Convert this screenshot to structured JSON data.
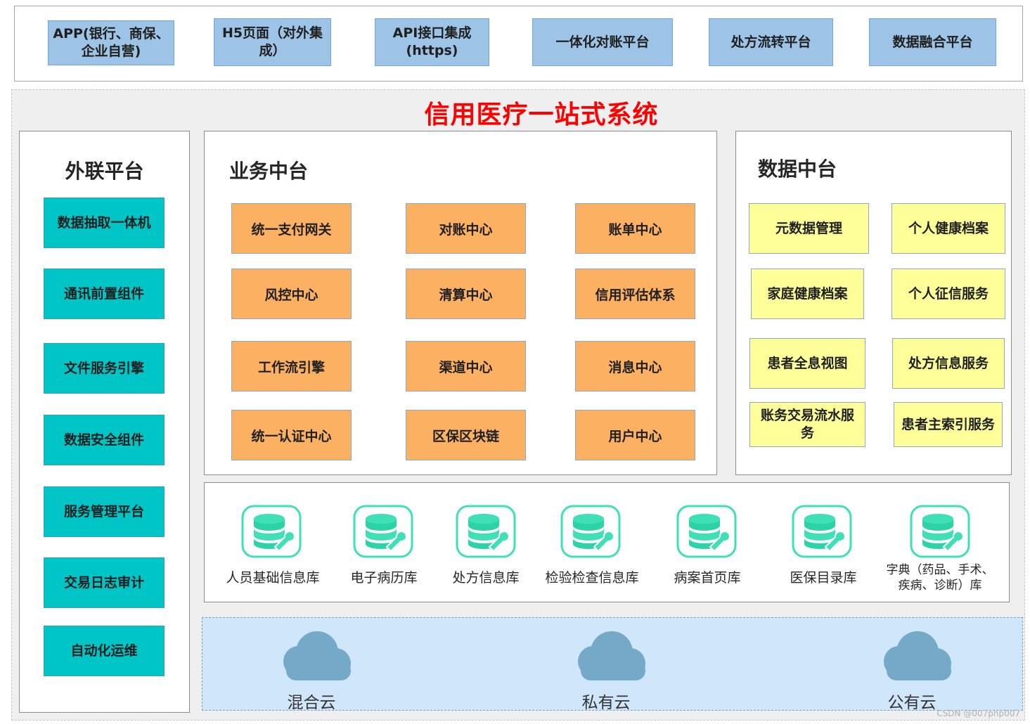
{
  "top_bar": {
    "items": [
      "APP(银行、商保、企业自营)",
      "H5页面（对外集成）",
      "API接口集成(https)",
      "一体化对账平台",
      "处方流转平台",
      "数据融合平台"
    ]
  },
  "system": {
    "title": "信用医疗一站式系统"
  },
  "external_platform": {
    "title": "外联平台",
    "items": [
      "数据抽取一体机",
      "通讯前置组件",
      "文件服务引擎",
      "数据安全组件",
      "服务管理平台",
      "交易日志审计",
      "自动化运维"
    ]
  },
  "business_middle": {
    "title": "业务中台",
    "items": [
      "统一支付网关",
      "对账中心",
      "账单中心",
      "风控中心",
      "清算中心",
      "信用评估体系",
      "工作流引擎",
      "渠道中心",
      "消息中心",
      "统一认证中心",
      "区保区块链",
      "用户中心"
    ]
  },
  "data_middle": {
    "title": "数据中台",
    "items": [
      "元数据管理",
      "个人健康档案",
      "家庭健康档案",
      "个人征信服务",
      "患者全息视图",
      "处方信息服务",
      "账务交易流水服务",
      "患者主索引服务"
    ]
  },
  "databases": {
    "icon": "database-icon",
    "items": [
      "人员基础信息库",
      "电子病历库",
      "处方信息库",
      "检验检查信息库",
      "病案首页库",
      "医保目录库",
      "字典（药品、手术、疾病、诊断）库"
    ]
  },
  "clouds": {
    "icon": "cloud-icon",
    "items": [
      "混合云",
      "私有云",
      "公有云"
    ]
  },
  "watermark": "CSDN @007php007",
  "colors": {
    "title_red": "#ff0000",
    "top_blue": "#9dc3e6",
    "teal": "#00c5c7",
    "orange": "#fbb062",
    "yellow": "#ffff99",
    "db_green": "#3fe0b5",
    "cloud_blue": "#74a9c8",
    "cloud_bg": "#cfe6fb"
  }
}
